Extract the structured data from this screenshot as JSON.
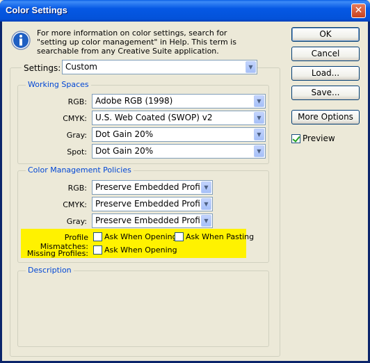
{
  "window": {
    "title": "Color Settings",
    "close_glyph": "✕"
  },
  "info": {
    "icon": "info-icon",
    "text": "For more information on color settings, search for \"setting up color management\" in Help. This term is searchable from any Creative Suite application."
  },
  "settings": {
    "label": "Settings:",
    "value": "Custom"
  },
  "working_spaces": {
    "title": "Working Spaces",
    "rgb_label": "RGB:",
    "rgb_value": "Adobe RGB (1998)",
    "cmyk_label": "CMYK:",
    "cmyk_value": "U.S. Web Coated (SWOP) v2",
    "gray_label": "Gray:",
    "gray_value": "Dot Gain 20%",
    "spot_label": "Spot:",
    "spot_value": "Dot Gain 20%"
  },
  "policies": {
    "title": "Color Management Policies",
    "rgb_label": "RGB:",
    "rgb_value": "Preserve Embedded Profi...",
    "cmyk_label": "CMYK:",
    "cmyk_value": "Preserve Embedded Profi...",
    "gray_label": "Gray:",
    "gray_value": "Preserve Embedded Profi...",
    "mismatch_label": "Profile Mismatches:",
    "ask_opening": "Ask When Opening",
    "ask_pasting": "Ask When Pasting",
    "missing_label": "Missing Profiles:",
    "missing_ask_opening": "Ask When Opening",
    "highlight_color": "#fff200"
  },
  "description": {
    "title": "Description"
  },
  "buttons": {
    "ok": "OK",
    "cancel": "Cancel",
    "load": "Load...",
    "save": "Save...",
    "more_options": "More Options",
    "preview": "Preview"
  },
  "colors": {
    "titlebar": "#0558e4",
    "group_label": "#0046d5",
    "dialog_bg": "#ece9d8"
  }
}
